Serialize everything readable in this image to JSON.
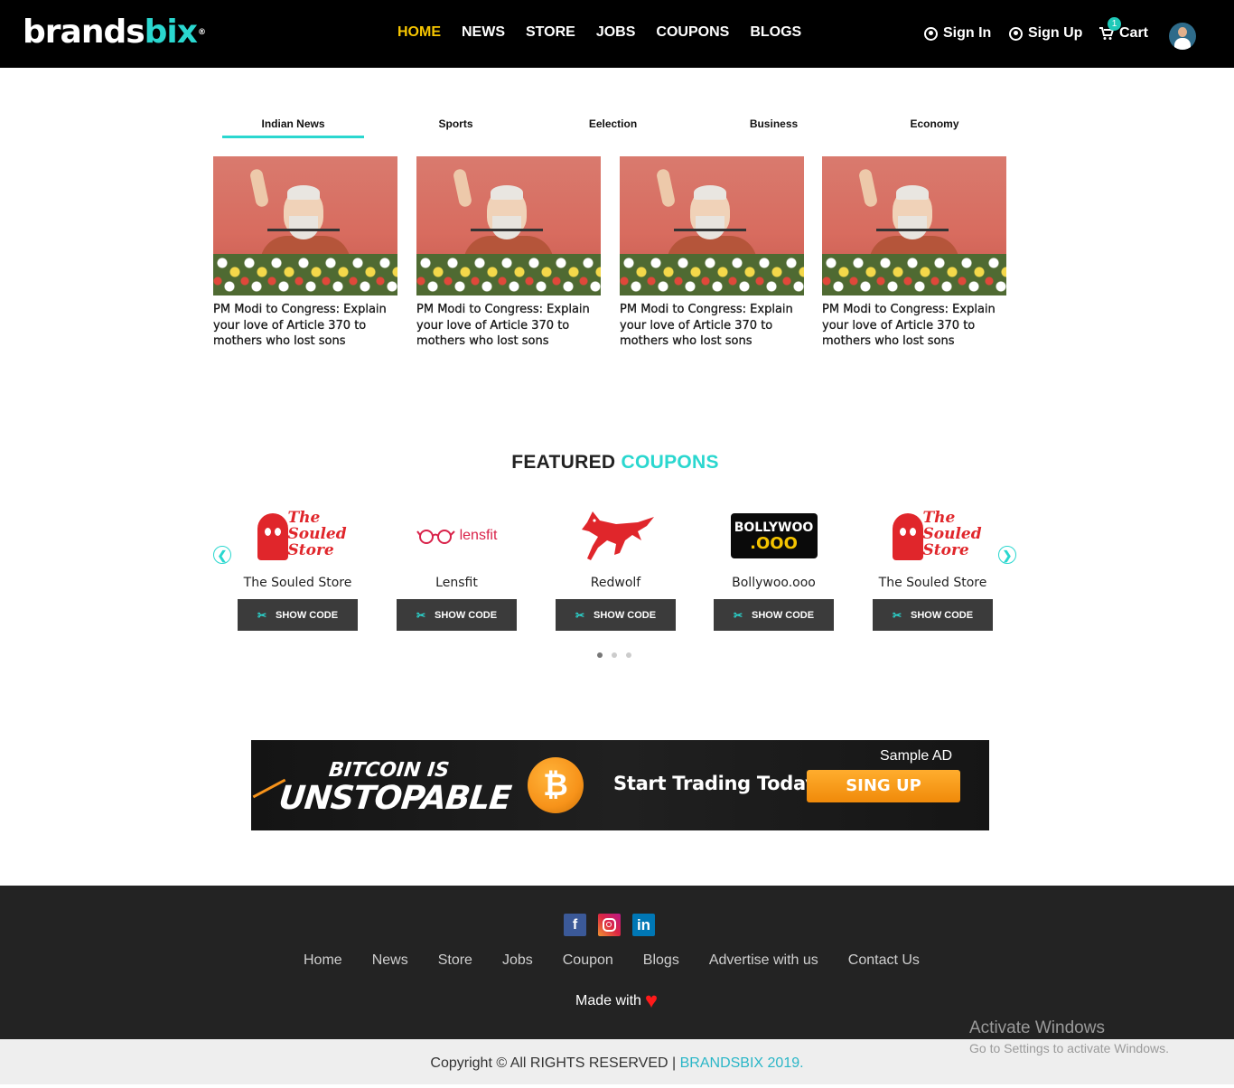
{
  "header": {
    "logo_main": "brands",
    "logo_accent": "bix",
    "logo_mark": "®",
    "nav": [
      "HOME",
      "NEWS",
      "STORE",
      "JOBS",
      "COUPONS",
      "BLOGS"
    ],
    "sign_in": "Sign In",
    "sign_up": "Sign Up",
    "cart_label": "Cart",
    "cart_count": "1"
  },
  "news": {
    "tabs": [
      "Indian News",
      "Sports",
      "Eelection",
      "Business",
      "Economy"
    ],
    "active_tab": "Indian News",
    "articles": [
      {
        "title": "PM Modi to Congress: Explain your love of Article 370 to mothers who lost sons"
      },
      {
        "title": "PM Modi to Congress: Explain your love of Article 370 to mothers who lost sons"
      },
      {
        "title": "PM Modi to Congress: Explain your love of Article 370 to mothers who lost sons"
      },
      {
        "title": "PM Modi to Congress: Explain your love of Article 370 to mothers who lost sons"
      }
    ]
  },
  "coupons": {
    "title_main": "FEATURED",
    "title_accent": "COUPONS",
    "prev_icon": "❮",
    "next_icon": "❯",
    "button_label": "SHOW CODE",
    "items": [
      {
        "name": "The Souled Store",
        "logo_text": "The Souled Store"
      },
      {
        "name": "Lensfit",
        "logo_text": "lensfit"
      },
      {
        "name": "Redwolf",
        "logo_text": ""
      },
      {
        "name": "Bollywoo.ooo",
        "logo_text": "BOLLYWOO",
        "logo_text2": ".OOO"
      },
      {
        "name": "The Souled Store",
        "logo_text": "The Souled Store"
      }
    ],
    "active_page": 1,
    "page_count": 3
  },
  "ad": {
    "line1": "BITCOIN IS",
    "line2": "UNSTOPABLE",
    "coin": "₿",
    "tagline": "Start Trading Today",
    "cta": "SING UP",
    "sample": "Sample AD"
  },
  "footer": {
    "social": [
      "facebook-icon",
      "instagram-icon",
      "linkedin-icon"
    ],
    "links": [
      "Home",
      "News",
      "Store",
      "Jobs",
      "Coupon",
      "Blogs",
      "Advertise with us",
      "Contact Us"
    ],
    "made_with": "Made with",
    "copyright": "Copyright © All RIGHTS RESERVED |",
    "copyright_brand": "BRANDSBIX 2019."
  },
  "watermark": {
    "line1": "Activate Windows",
    "line2": "Go to Settings to activate Windows."
  },
  "colors": {
    "accent": "#2ad7cf",
    "nav_active": "#f7c600",
    "header_bg": "#000000",
    "footer_bg": "#232323"
  }
}
